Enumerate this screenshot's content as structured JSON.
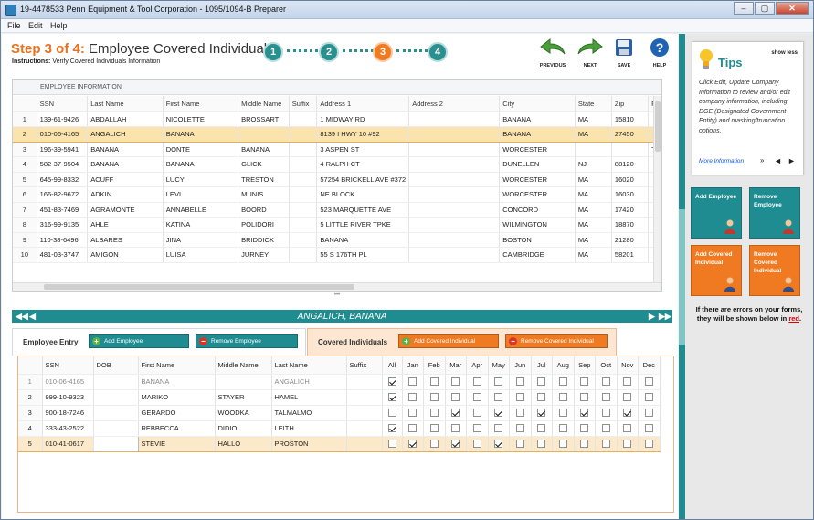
{
  "window": {
    "title": "19-4478533 Penn Equipment & Tool Corporation - 1095/1094-B Preparer",
    "min": "–",
    "max": "▢",
    "close": "✕"
  },
  "menu": [
    "File",
    "Edit",
    "Help"
  ],
  "header": {
    "step_prefix": "Step 3 of 4:",
    "step_title": " Employee Covered Individuals",
    "instructions_label": "Instructions:",
    "instructions_text": " Verify Covered Individuals Information",
    "steps": [
      "1",
      "2",
      "3",
      "4"
    ],
    "active_step": 3
  },
  "toolbar": {
    "previous": "PREVIOUS",
    "next": "NEXT",
    "save": "SAVE",
    "help": "HELP"
  },
  "employee_grid": {
    "section_title": "EMPLOYEE INFORMATION",
    "columns": [
      "SSN",
      "Last Name",
      "First Name",
      "Middle Name",
      "Suffix",
      "Address 1",
      "Address 2",
      "City",
      "State",
      "Zip",
      "F"
    ],
    "rows": [
      [
        "1",
        "139-61-9426",
        "ABDALLAH",
        "NICOLETTE",
        "BROSSART",
        "",
        "1 MIDWAY RD",
        "",
        "BANANA",
        "MA",
        "15810",
        ""
      ],
      [
        "2",
        "010-06-4165",
        "ANGALICH",
        "BANANA",
        "",
        "",
        "8139 I HWY 10 #92",
        "",
        "BANANA",
        "MA",
        "27450",
        ""
      ],
      [
        "3",
        "196-39-5941",
        "BANANA",
        "DONTE",
        "BANANA",
        "",
        "3 ASPEN ST",
        "",
        "WORCESTER",
        "",
        "",
        "T"
      ],
      [
        "4",
        "582-37-9504",
        "BANANA",
        "BANANA",
        "GLICK",
        "",
        "4 RALPH CT",
        "",
        "DUNELLEN",
        "NJ",
        "88120",
        ""
      ],
      [
        "5",
        "645-99-8332",
        "ACUFF",
        "LUCY",
        "TRESTON",
        "",
        "57254 BRICKELL AVE #372",
        "",
        "WORCESTER",
        "MA",
        "16020",
        ""
      ],
      [
        "6",
        "166-82-9672",
        "ADKIN",
        "LEVI",
        "MUNIS",
        "",
        "NE BLOCK",
        "",
        "WORCESTER",
        "MA",
        "16030",
        ""
      ],
      [
        "7",
        "451-83-7469",
        "AGRAMONTE",
        "ANNABELLE",
        "BOORD",
        "",
        "523 MARQUETTE AVE",
        "",
        "CONCORD",
        "MA",
        "17420",
        ""
      ],
      [
        "8",
        "316-99-9135",
        "AHLE",
        "KATINA",
        "POLIDORI",
        "",
        "5 LITTLE RIVER TPKE",
        "",
        "WILMINGTON",
        "MA",
        "18870",
        ""
      ],
      [
        "9",
        "110-38-6496",
        "ALBARES",
        "JINA",
        "BRIDDICK",
        "",
        "BANANA",
        "",
        "BOSTON",
        "MA",
        "21280",
        ""
      ],
      [
        "10",
        "481-03-3747",
        "AMIGON",
        "LUISA",
        "JURNEY",
        "",
        "55 S 176TH PL",
        "",
        "CAMBRIDGE",
        "MA",
        "58201",
        ""
      ]
    ],
    "selected_row": 2
  },
  "splitter": "•••",
  "selected_employee": {
    "name": "ANGALICH, BANANA",
    "first": "▶▶",
    "prev": "◀",
    "next": "▶",
    "last": "▶▶"
  },
  "tabs": {
    "employee_entry": "Employee Entry",
    "add_employee": "Add Employee",
    "remove_employee": "Remove Employee",
    "covered_individuals": "Covered Individuals",
    "add_covered": "Add Covered Individual",
    "remove_covered": "Remove Covered Individual"
  },
  "covered_grid": {
    "columns": [
      "SSN",
      "DOB",
      "First Name",
      "Middle Name",
      "Last Name",
      "Suffix",
      "All",
      "Jan",
      "Feb",
      "Mar",
      "Apr",
      "May",
      "Jun",
      "Jul",
      "Aug",
      "Sep",
      "Oct",
      "Nov",
      "Dec"
    ],
    "rows": [
      {
        "n": "1",
        "ssn": "010-06-4165",
        "dob": "",
        "first": "BANANA",
        "middle": "",
        "last": "ANGALICH",
        "suffix": "",
        "all": true,
        "months": [
          false,
          false,
          false,
          false,
          false,
          false,
          false,
          false,
          false,
          false,
          false,
          false
        ]
      },
      {
        "n": "2",
        "ssn": "999-10-9323",
        "dob": "",
        "first": "MARIKO",
        "middle": "STAYER",
        "last": "HAMEL",
        "suffix": "",
        "all": true,
        "months": [
          false,
          false,
          false,
          false,
          false,
          false,
          false,
          false,
          false,
          false,
          false,
          false
        ]
      },
      {
        "n": "3",
        "ssn": "900-18-7246",
        "dob": "",
        "first": "GERARDO",
        "middle": "WOODKA",
        "last": "TALMALMO",
        "suffix": "",
        "all": false,
        "months": [
          false,
          false,
          true,
          false,
          true,
          false,
          true,
          false,
          true,
          false,
          true,
          false
        ]
      },
      {
        "n": "4",
        "ssn": "333-43-2522",
        "dob": "",
        "first": "REBBECCA",
        "middle": "DIDIO",
        "last": "LEITH",
        "suffix": "",
        "all": true,
        "months": [
          false,
          false,
          false,
          false,
          false,
          false,
          false,
          false,
          false,
          false,
          false,
          false
        ]
      },
      {
        "n": "5",
        "ssn": "010-41-0617",
        "dob": "",
        "first": "STEVIE",
        "middle": "HALLO",
        "last": "PROSTON",
        "suffix": "",
        "all": false,
        "months": [
          true,
          false,
          true,
          false,
          true,
          false,
          false,
          false,
          false,
          false,
          false,
          false
        ]
      }
    ]
  },
  "tips": {
    "show_less": "show less",
    "title": "Tips",
    "text": "Click Edit, Update Company Information to review and/or edit company information, including DGE (Designated Government Entity) and masking/truncation options.",
    "more": "More Information",
    "more_suffix": " »",
    "prev": "◄",
    "next": "►"
  },
  "side_buttons": {
    "add_employee": "Add Employee",
    "remove_employee": "Remove Employee",
    "add_covered": "Add Covered Individual",
    "remove_covered": "Remove Covered Individual"
  },
  "errors_note": {
    "prefix": "If there are errors on your forms, they will be shown below in ",
    "red": "red",
    "suffix": "."
  },
  "colors": {
    "teal": "#1e8c90",
    "orange": "#f07a22",
    "selected_row": "#fbe3ad"
  }
}
